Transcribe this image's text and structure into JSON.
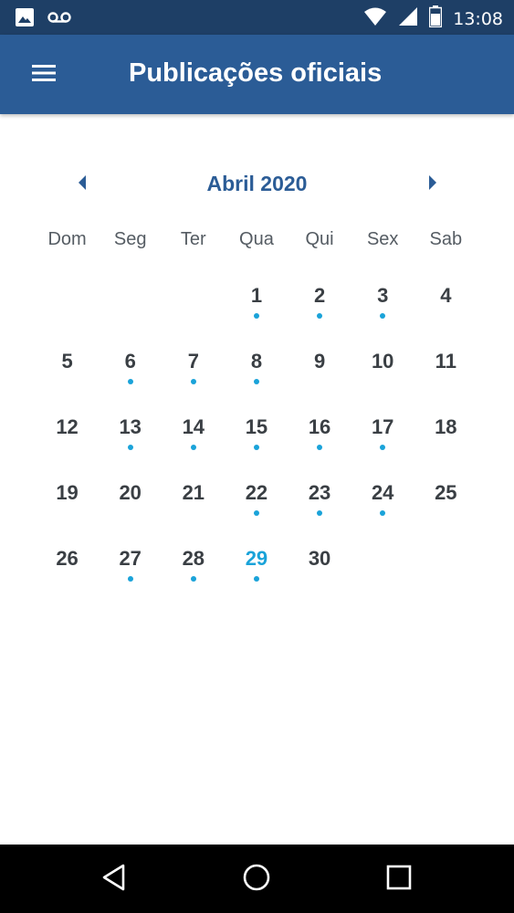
{
  "status_bar": {
    "time": "13:08",
    "left_icons": [
      "image-icon",
      "voicemail-icon"
    ],
    "right_icons": [
      "wifi-icon",
      "signal-icon",
      "battery-icon"
    ]
  },
  "app_bar": {
    "title": "Publicações oficiais",
    "menu_icon": "menu-icon"
  },
  "calendar": {
    "month_label": "Abril 2020",
    "weekdays": [
      "Dom",
      "Seg",
      "Ter",
      "Qua",
      "Qui",
      "Sex",
      "Sab"
    ],
    "first_weekday_index": 3,
    "days_in_month": 30,
    "today": 29,
    "days_with_publications": [
      1,
      2,
      3,
      6,
      7,
      8,
      13,
      14,
      15,
      16,
      17,
      22,
      23,
      24,
      27,
      28,
      29
    ]
  },
  "colors": {
    "status_bar": "#1e3f66",
    "app_bar": "#2b5c96",
    "accent": "#1aa3d9",
    "day_text": "#3a3f44",
    "weekday_text": "#555c63"
  },
  "nav_bar": {
    "icons": [
      "back-icon",
      "home-icon",
      "recents-icon"
    ]
  }
}
